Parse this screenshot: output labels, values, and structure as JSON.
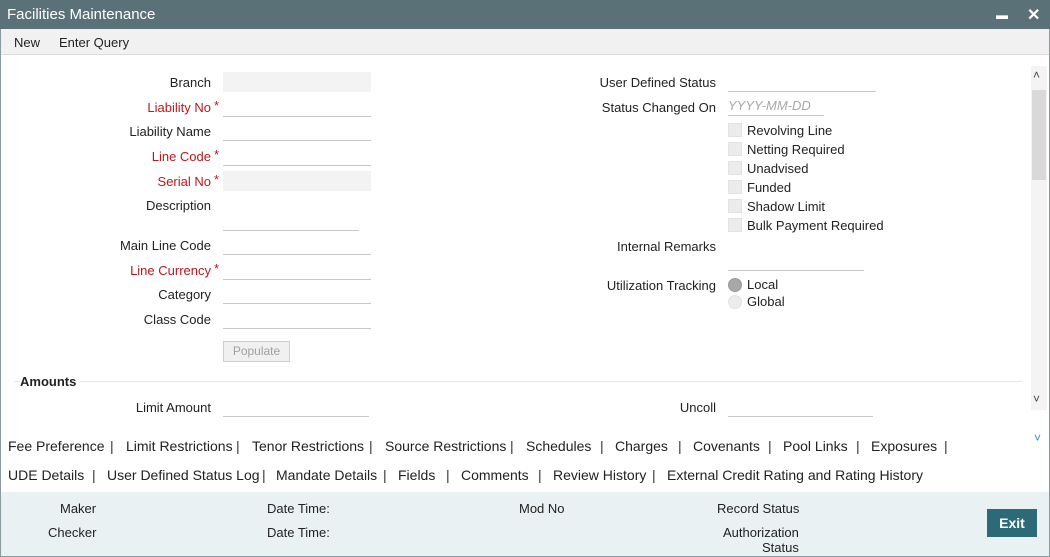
{
  "window": {
    "title": "Facilities Maintenance",
    "minimize_glyph": "▬",
    "close_glyph": "✕"
  },
  "menu": {
    "new": "New",
    "enter_query": "Enter Query"
  },
  "required_mark": "*",
  "form_left": {
    "branch": {
      "label": "Branch",
      "value": ""
    },
    "liability_no": {
      "label": "Liability No",
      "value": ""
    },
    "liability_name": {
      "label": "Liability Name",
      "value": ""
    },
    "line_code": {
      "label": "Line Code",
      "value": ""
    },
    "serial_no": {
      "label": "Serial No",
      "value": ""
    },
    "description": {
      "label": "Description",
      "value": ""
    },
    "main_line_code": {
      "label": "Main Line Code",
      "value": ""
    },
    "line_currency": {
      "label": "Line Currency",
      "value": ""
    },
    "category": {
      "label": "Category",
      "value": ""
    },
    "class_code": {
      "label": "Class Code",
      "value": ""
    },
    "populate_button": "Populate"
  },
  "form_right": {
    "user_defined_status": {
      "label": "User Defined Status",
      "value": ""
    },
    "status_changed_on": {
      "label": "Status Changed On",
      "placeholder": "YYYY-MM-DD"
    },
    "checkboxes": {
      "revolving_line": "Revolving Line",
      "netting_required": "Netting Required",
      "unadvised": "Unadvised",
      "funded": "Funded",
      "shadow_limit": "Shadow Limit",
      "bulk_payment_required": "Bulk Payment Required"
    },
    "internal_remarks": {
      "label": "Internal Remarks",
      "value": ""
    },
    "utilization_tracking": {
      "label": "Utilization Tracking",
      "local": "Local",
      "global": "Global",
      "selected": "Local"
    }
  },
  "amounts": {
    "section_title": "Amounts",
    "limit_amount": {
      "label": "Limit Amount",
      "value": ""
    },
    "uncoll": {
      "label": "Uncoll",
      "value": ""
    }
  },
  "tabs_row1": [
    "Fee Preference",
    "Limit Restrictions",
    "Tenor Restrictions",
    "Source Restrictions",
    "Schedules",
    "Charges",
    "Covenants",
    "Pool Links",
    "Exposures"
  ],
  "tabs_row2": [
    "UDE Details",
    "User Defined Status Log",
    "Mandate Details",
    "Fields",
    "Comments",
    "Review History",
    "External Credit Rating and Rating History"
  ],
  "tab_separator": "|",
  "footer": {
    "maker": "Maker",
    "date_time_1": "Date Time:",
    "mod_no": "Mod No",
    "record_status": "Record Status",
    "checker": "Checker",
    "date_time_2": "Date Time:",
    "authorization": "Authorization",
    "status": "Status"
  },
  "exit_button": "Exit",
  "colors": {
    "title_bar": "#5b7178",
    "required": "#c0161a",
    "exit_button": "#2d6a78",
    "footer_bg": "#e9f1f3",
    "radio_selected": "#a8a8a8"
  },
  "icons": {
    "scroll_up": "chevron-up-icon",
    "scroll_down": "chevron-down-icon",
    "tabs_expand": "chevron-down-icon"
  }
}
